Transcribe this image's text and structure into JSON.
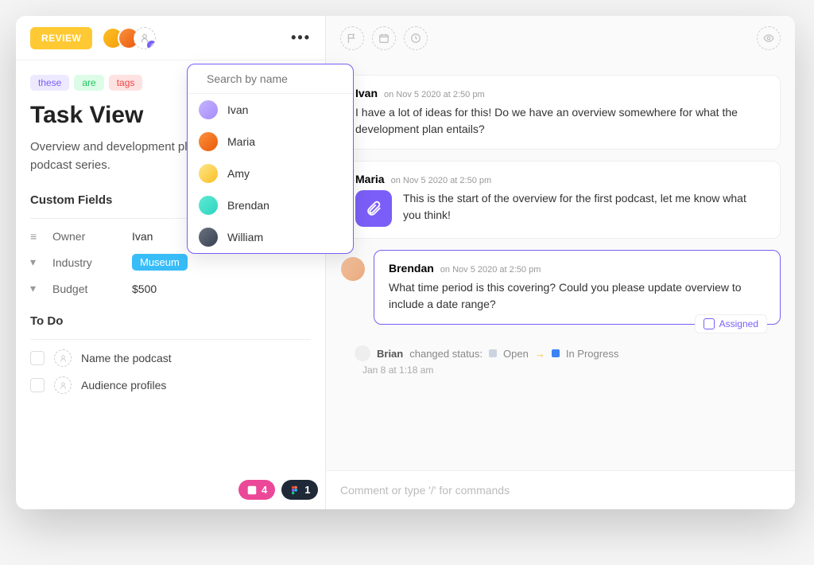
{
  "header": {
    "review_label": "REVIEW"
  },
  "dropdown": {
    "search_placeholder": "Search by name",
    "items": [
      {
        "name": "Ivan"
      },
      {
        "name": "Maria"
      },
      {
        "name": "Amy"
      },
      {
        "name": "Brendan"
      },
      {
        "name": "William"
      }
    ]
  },
  "tags": [
    {
      "text": "these",
      "cls": "purple"
    },
    {
      "text": "are",
      "cls": "green"
    },
    {
      "text": "tags",
      "cls": "red"
    }
  ],
  "title": "Task View",
  "description": "Overview and development plan for the original podcast series.",
  "custom_fields": {
    "heading": "Custom Fields",
    "rows": [
      {
        "label": "Owner",
        "value": "Ivan",
        "type": "text"
      },
      {
        "label": "Industry",
        "value": "Museum",
        "type": "pill"
      },
      {
        "label": "Budget",
        "value": "$500",
        "type": "text"
      }
    ]
  },
  "todo": {
    "heading": "To Do",
    "items": [
      "Name the podcast",
      "Audience profiles"
    ]
  },
  "footer_badges": [
    {
      "count": "4",
      "cls": "pink"
    },
    {
      "count": "1",
      "cls": "dark"
    }
  ],
  "comments": [
    {
      "author": "Ivan",
      "time": "on Nov 5 2020 at 2:50 pm",
      "text": "I have a lot of ideas for this! Do we have an overview somewhere for what the development plan entails?"
    },
    {
      "author": "Maria",
      "time": "on Nov 5 2020 at 2:50 pm",
      "text": "This is the start of the overview for the first podcast, let me know what you think!",
      "attachment": true
    },
    {
      "author": "Brendan",
      "time": "on Nov 5 2020 at 2:50 pm",
      "text": "What time period is this covering? Could you please update overview to include a date range?",
      "assigned": true
    }
  ],
  "assigned_label": "Assigned",
  "activity": {
    "user": "Brian",
    "action": "changed status:",
    "from": "Open",
    "to": "In Progress",
    "time": "Jan 8 at 1:18 am"
  },
  "comment_placeholder": "Comment or type '/' for commands"
}
